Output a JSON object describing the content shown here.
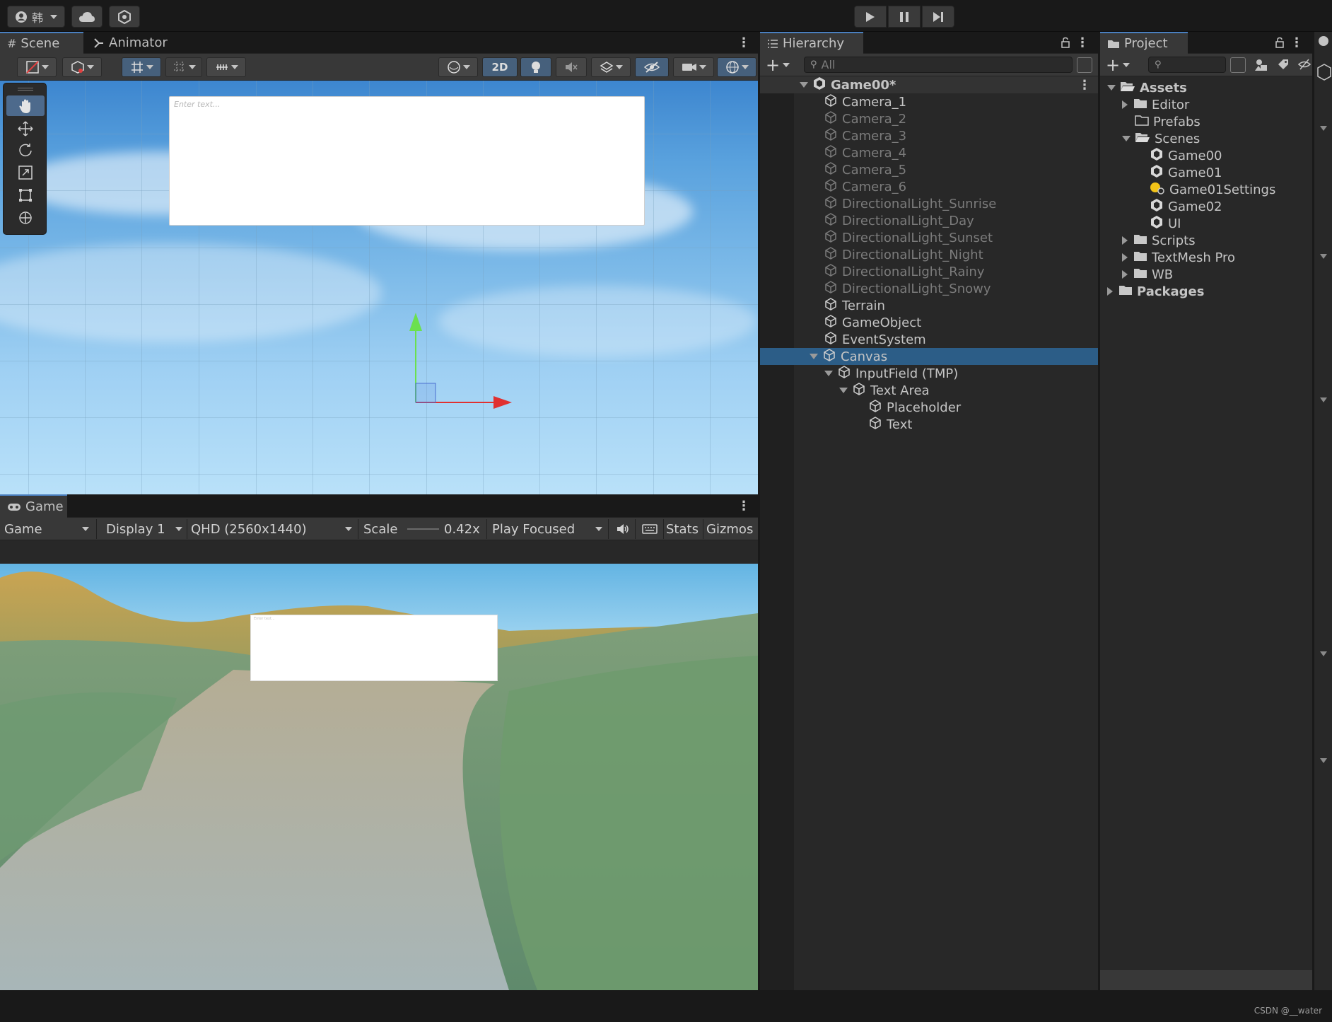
{
  "toolbar": {
    "account_label": "韩",
    "icons": [
      "account-icon",
      "cloud-icon",
      "collab-icon",
      "play-icon",
      "pause-icon",
      "step-icon"
    ]
  },
  "scene_panel": {
    "tabs": [
      {
        "label": "Scene",
        "icon": "grid-hash-icon"
      },
      {
        "label": "Animator",
        "icon": "animator-icon"
      }
    ],
    "mode_2d_label": "2D",
    "input_placeholder": "Enter text..."
  },
  "game_panel": {
    "tab_label": "Game",
    "toolbar": {
      "game_dropdown": "Game",
      "display_dropdown": "Display 1",
      "resolution_dropdown": "QHD (2560x1440)",
      "scale_label": "Scale",
      "scale_value": "0.42x",
      "play_mode_dropdown": "Play Focused",
      "stats_label": "Stats",
      "gizmos_label": "Gizmos"
    },
    "input_placeholder": "Enter text..."
  },
  "hierarchy": {
    "tab_label": "Hierarchy",
    "search_placeholder": "All",
    "root": "Game00*",
    "items": [
      {
        "label": "Camera_1",
        "depth": 1,
        "dim": false
      },
      {
        "label": "Camera_2",
        "depth": 1,
        "dim": true
      },
      {
        "label": "Camera_3",
        "depth": 1,
        "dim": true
      },
      {
        "label": "Camera_4",
        "depth": 1,
        "dim": true
      },
      {
        "label": "Camera_5",
        "depth": 1,
        "dim": true
      },
      {
        "label": "Camera_6",
        "depth": 1,
        "dim": true
      },
      {
        "label": "DirectionalLight_Sunrise",
        "depth": 1,
        "dim": true
      },
      {
        "label": "DirectionalLight_Day",
        "depth": 1,
        "dim": true
      },
      {
        "label": "DirectionalLight_Sunset",
        "depth": 1,
        "dim": true
      },
      {
        "label": "DirectionalLight_Night",
        "depth": 1,
        "dim": true
      },
      {
        "label": "DirectionalLight_Rainy",
        "depth": 1,
        "dim": true
      },
      {
        "label": "DirectionalLight_Snowy",
        "depth": 1,
        "dim": true
      },
      {
        "label": "Terrain",
        "depth": 1,
        "dim": false
      },
      {
        "label": "GameObject",
        "depth": 1,
        "dim": false
      },
      {
        "label": "EventSystem",
        "depth": 1,
        "dim": false
      },
      {
        "label": "Canvas",
        "depth": 1,
        "dim": false,
        "selected": true,
        "expanded": true
      },
      {
        "label": "InputField (TMP)",
        "depth": 2,
        "dim": false,
        "expanded": true
      },
      {
        "label": "Text Area",
        "depth": 3,
        "dim": false,
        "expanded": true
      },
      {
        "label": "Placeholder",
        "depth": 4,
        "dim": false
      },
      {
        "label": "Text",
        "depth": 4,
        "dim": false
      }
    ]
  },
  "project": {
    "tab_label": "Project",
    "items": [
      {
        "label": "Assets",
        "depth": 0,
        "kind": "folder-open",
        "arrow": "down",
        "bold": true
      },
      {
        "label": "Editor",
        "depth": 1,
        "kind": "folder",
        "arrow": "right"
      },
      {
        "label": "Prefabs",
        "depth": 1,
        "kind": "folder-empty",
        "arrow": "none"
      },
      {
        "label": "Scenes",
        "depth": 1,
        "kind": "folder-open",
        "arrow": "down"
      },
      {
        "label": "Game00",
        "depth": 2,
        "kind": "scene",
        "arrow": "none"
      },
      {
        "label": "Game01",
        "depth": 2,
        "kind": "scene",
        "arrow": "none"
      },
      {
        "label": "Game01Settings",
        "depth": 2,
        "kind": "lighting",
        "arrow": "none"
      },
      {
        "label": "Game02",
        "depth": 2,
        "kind": "scene",
        "arrow": "none"
      },
      {
        "label": "UI",
        "depth": 2,
        "kind": "scene",
        "arrow": "none"
      },
      {
        "label": "Scripts",
        "depth": 1,
        "kind": "folder",
        "arrow": "right"
      },
      {
        "label": "TextMesh Pro",
        "depth": 1,
        "kind": "folder",
        "arrow": "right"
      },
      {
        "label": "WB",
        "depth": 1,
        "kind": "folder",
        "arrow": "right"
      },
      {
        "label": "Packages",
        "depth": 0,
        "kind": "folder",
        "arrow": "right",
        "bold": true
      }
    ]
  },
  "watermark": "CSDN @__water",
  "colors": {
    "selection": "#2c5d87",
    "accent_tab": "#4a7fbf",
    "panel_bg": "#282828",
    "toolbar_bg": "#383838"
  }
}
